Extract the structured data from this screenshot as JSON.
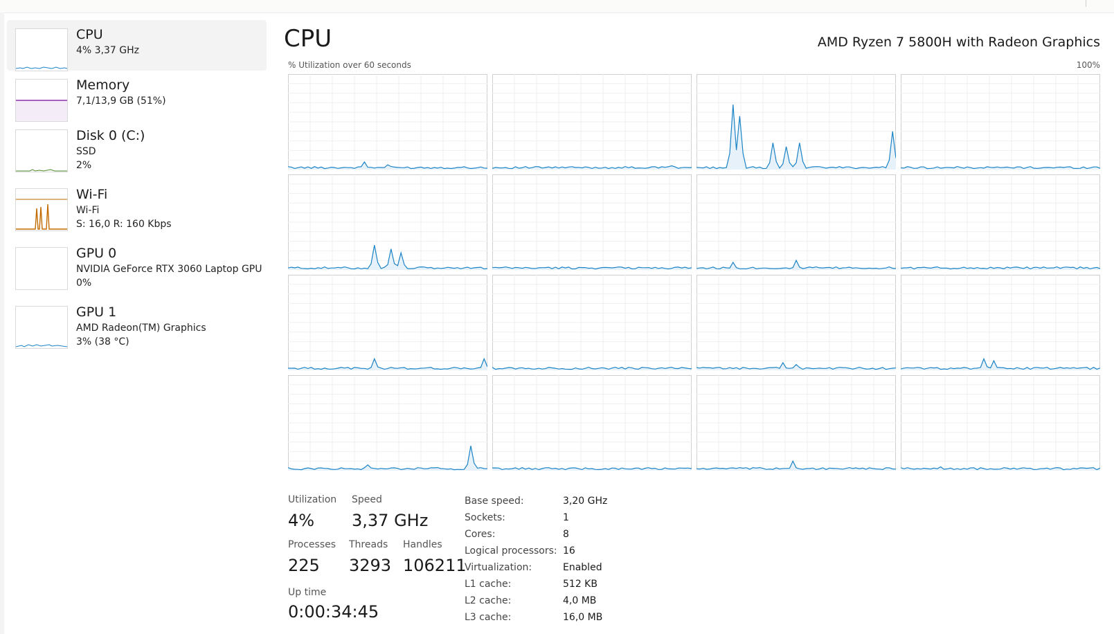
{
  "sidebar": {
    "items": [
      {
        "title": "CPU",
        "line1": "4%  3,37 GHz",
        "line2": "",
        "color": "#1a83c6"
      },
      {
        "title": "Memory",
        "line1": "7,1/13,9 GB (51%)",
        "line2": "",
        "color": "#8b2fa8"
      },
      {
        "title": "Disk 0 (C:)",
        "line1": "SSD",
        "line2": "2%",
        "color": "#4a8a2a"
      },
      {
        "title": "Wi-Fi",
        "line1": "Wi-Fi",
        "line2": "S: 16,0  R: 160 Kbps",
        "color": "#c26a00"
      },
      {
        "title": "GPU 0",
        "line1": "NVIDIA GeForce RTX 3060 Laptop GPU",
        "line2": "0%",
        "color": "#1a83c6"
      },
      {
        "title": "GPU 1",
        "line1": "AMD Radeon(TM) Graphics",
        "line2": "3% (38 °C)",
        "color": "#1a83c6"
      }
    ],
    "icons": {
      "cpu": "cpu-graph-icon",
      "memory": "memory-graph-icon",
      "disk": "disk-graph-icon",
      "wifi": "wifi-graph-icon",
      "gpu0": "gpu0-graph-icon",
      "gpu1": "gpu1-graph-icon"
    }
  },
  "main": {
    "title": "CPU",
    "cpu_model": "AMD Ryzen 7 5800H with Radeon Graphics",
    "graph_label": "% Utilization over 60 seconds",
    "graph_max": "100%",
    "line_color": "#1a83c6",
    "fill_color": "#e6f1f9",
    "grid_color": "#dcdcdc"
  },
  "stats": {
    "utilization_label": "Utilization",
    "utilization_value": "4%",
    "speed_label": "Speed",
    "speed_value": "3,37 GHz",
    "processes_label": "Processes",
    "processes_value": "225",
    "threads_label": "Threads",
    "threads_value": "3293",
    "handles_label": "Handles",
    "handles_value": "106211",
    "uptime_label": "Up time",
    "uptime_value": "0:00:34:45"
  },
  "details": [
    {
      "key": "Base speed:",
      "value": "3,20 GHz"
    },
    {
      "key": "Sockets:",
      "value": "1"
    },
    {
      "key": "Cores:",
      "value": "8"
    },
    {
      "key": "Logical processors:",
      "value": "16"
    },
    {
      "key": "Virtualization:",
      "value": "Enabled"
    },
    {
      "key": "L1 cache:",
      "value": "512 KB"
    },
    {
      "key": "L2 cache:",
      "value": "4,0 MB"
    },
    {
      "key": "L3 cache:",
      "value": "16,0 MB"
    }
  ],
  "core_graphs": [
    {
      "core": 0,
      "peaks": [
        [
          0.38,
          8
        ],
        [
          0.5,
          5
        ]
      ]
    },
    {
      "core": 1,
      "peaks": [
        [
          0.2,
          2
        ],
        [
          0.9,
          4
        ]
      ]
    },
    {
      "core": 2,
      "peaks": [
        [
          0.18,
          68
        ],
        [
          0.22,
          56
        ],
        [
          0.38,
          28
        ],
        [
          0.45,
          24
        ],
        [
          0.52,
          28
        ],
        [
          0.98,
          40
        ]
      ]
    },
    {
      "core": 3,
      "peaks": []
    },
    {
      "core": 4,
      "peaks": [
        [
          0.44,
          26
        ],
        [
          0.52,
          22
        ],
        [
          0.57,
          18
        ]
      ]
    },
    {
      "core": 5,
      "peaks": []
    },
    {
      "core": 6,
      "peaks": [
        [
          0.18,
          8
        ],
        [
          0.5,
          10
        ]
      ]
    },
    {
      "core": 7,
      "peaks": []
    },
    {
      "core": 8,
      "peaks": [
        [
          0.44,
          12
        ],
        [
          0.98,
          12
        ]
      ]
    },
    {
      "core": 9,
      "peaks": []
    },
    {
      "core": 10,
      "peaks": [
        [
          0.44,
          8
        ],
        [
          0.5,
          6
        ]
      ]
    },
    {
      "core": 11,
      "peaks": [
        [
          0.42,
          12
        ],
        [
          0.46,
          10
        ]
      ]
    },
    {
      "core": 12,
      "peaks": [
        [
          0.4,
          6
        ],
        [
          0.92,
          26
        ]
      ]
    },
    {
      "core": 13,
      "peaks": []
    },
    {
      "core": 14,
      "peaks": [
        [
          0.48,
          10
        ]
      ]
    },
    {
      "core": 15,
      "peaks": [
        [
          0.2,
          4
        ]
      ]
    }
  ]
}
